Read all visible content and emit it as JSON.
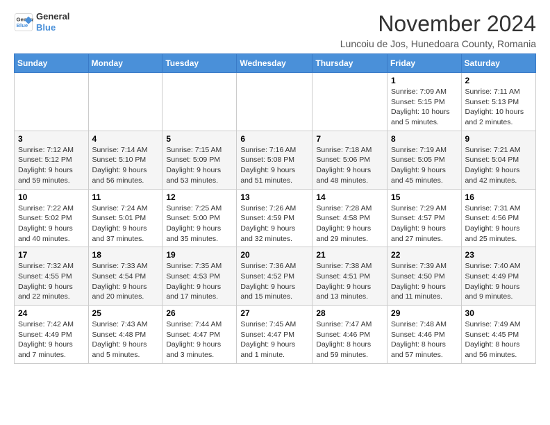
{
  "logo": {
    "line1": "General",
    "line2": "Blue"
  },
  "header": {
    "month_title": "November 2024",
    "subtitle": "Luncoiu de Jos, Hunedoara County, Romania"
  },
  "weekdays": [
    "Sunday",
    "Monday",
    "Tuesday",
    "Wednesday",
    "Thursday",
    "Friday",
    "Saturday"
  ],
  "weeks": [
    [
      {
        "day": "",
        "info": ""
      },
      {
        "day": "",
        "info": ""
      },
      {
        "day": "",
        "info": ""
      },
      {
        "day": "",
        "info": ""
      },
      {
        "day": "",
        "info": ""
      },
      {
        "day": "1",
        "info": "Sunrise: 7:09 AM\nSunset: 5:15 PM\nDaylight: 10 hours and 5 minutes."
      },
      {
        "day": "2",
        "info": "Sunrise: 7:11 AM\nSunset: 5:13 PM\nDaylight: 10 hours and 2 minutes."
      }
    ],
    [
      {
        "day": "3",
        "info": "Sunrise: 7:12 AM\nSunset: 5:12 PM\nDaylight: 9 hours and 59 minutes."
      },
      {
        "day": "4",
        "info": "Sunrise: 7:14 AM\nSunset: 5:10 PM\nDaylight: 9 hours and 56 minutes."
      },
      {
        "day": "5",
        "info": "Sunrise: 7:15 AM\nSunset: 5:09 PM\nDaylight: 9 hours and 53 minutes."
      },
      {
        "day": "6",
        "info": "Sunrise: 7:16 AM\nSunset: 5:08 PM\nDaylight: 9 hours and 51 minutes."
      },
      {
        "day": "7",
        "info": "Sunrise: 7:18 AM\nSunset: 5:06 PM\nDaylight: 9 hours and 48 minutes."
      },
      {
        "day": "8",
        "info": "Sunrise: 7:19 AM\nSunset: 5:05 PM\nDaylight: 9 hours and 45 minutes."
      },
      {
        "day": "9",
        "info": "Sunrise: 7:21 AM\nSunset: 5:04 PM\nDaylight: 9 hours and 42 minutes."
      }
    ],
    [
      {
        "day": "10",
        "info": "Sunrise: 7:22 AM\nSunset: 5:02 PM\nDaylight: 9 hours and 40 minutes."
      },
      {
        "day": "11",
        "info": "Sunrise: 7:24 AM\nSunset: 5:01 PM\nDaylight: 9 hours and 37 minutes."
      },
      {
        "day": "12",
        "info": "Sunrise: 7:25 AM\nSunset: 5:00 PM\nDaylight: 9 hours and 35 minutes."
      },
      {
        "day": "13",
        "info": "Sunrise: 7:26 AM\nSunset: 4:59 PM\nDaylight: 9 hours and 32 minutes."
      },
      {
        "day": "14",
        "info": "Sunrise: 7:28 AM\nSunset: 4:58 PM\nDaylight: 9 hours and 29 minutes."
      },
      {
        "day": "15",
        "info": "Sunrise: 7:29 AM\nSunset: 4:57 PM\nDaylight: 9 hours and 27 minutes."
      },
      {
        "day": "16",
        "info": "Sunrise: 7:31 AM\nSunset: 4:56 PM\nDaylight: 9 hours and 25 minutes."
      }
    ],
    [
      {
        "day": "17",
        "info": "Sunrise: 7:32 AM\nSunset: 4:55 PM\nDaylight: 9 hours and 22 minutes."
      },
      {
        "day": "18",
        "info": "Sunrise: 7:33 AM\nSunset: 4:54 PM\nDaylight: 9 hours and 20 minutes."
      },
      {
        "day": "19",
        "info": "Sunrise: 7:35 AM\nSunset: 4:53 PM\nDaylight: 9 hours and 17 minutes."
      },
      {
        "day": "20",
        "info": "Sunrise: 7:36 AM\nSunset: 4:52 PM\nDaylight: 9 hours and 15 minutes."
      },
      {
        "day": "21",
        "info": "Sunrise: 7:38 AM\nSunset: 4:51 PM\nDaylight: 9 hours and 13 minutes."
      },
      {
        "day": "22",
        "info": "Sunrise: 7:39 AM\nSunset: 4:50 PM\nDaylight: 9 hours and 11 minutes."
      },
      {
        "day": "23",
        "info": "Sunrise: 7:40 AM\nSunset: 4:49 PM\nDaylight: 9 hours and 9 minutes."
      }
    ],
    [
      {
        "day": "24",
        "info": "Sunrise: 7:42 AM\nSunset: 4:49 PM\nDaylight: 9 hours and 7 minutes."
      },
      {
        "day": "25",
        "info": "Sunrise: 7:43 AM\nSunset: 4:48 PM\nDaylight: 9 hours and 5 minutes."
      },
      {
        "day": "26",
        "info": "Sunrise: 7:44 AM\nSunset: 4:47 PM\nDaylight: 9 hours and 3 minutes."
      },
      {
        "day": "27",
        "info": "Sunrise: 7:45 AM\nSunset: 4:47 PM\nDaylight: 9 hours and 1 minute."
      },
      {
        "day": "28",
        "info": "Sunrise: 7:47 AM\nSunset: 4:46 PM\nDaylight: 8 hours and 59 minutes."
      },
      {
        "day": "29",
        "info": "Sunrise: 7:48 AM\nSunset: 4:46 PM\nDaylight: 8 hours and 57 minutes."
      },
      {
        "day": "30",
        "info": "Sunrise: 7:49 AM\nSunset: 4:45 PM\nDaylight: 8 hours and 56 minutes."
      }
    ]
  ]
}
